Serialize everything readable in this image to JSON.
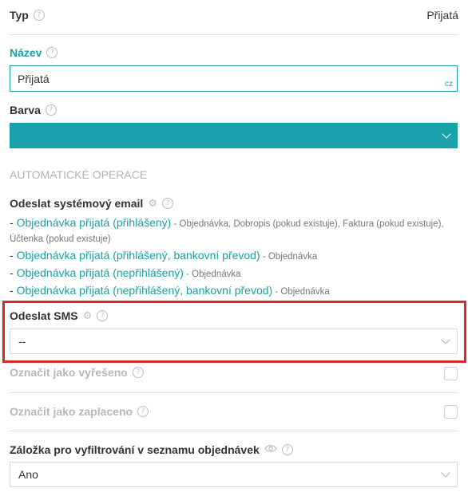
{
  "type": {
    "label": "Typ",
    "value": "Přijatá"
  },
  "name": {
    "label": "Název",
    "value": "Přijatá",
    "lang": "cz"
  },
  "color": {
    "label": "Barva",
    "value": "#1aa2ad"
  },
  "section_title": "AUTOMATICKÉ OPERACE",
  "email": {
    "label": "Odeslat systémový email",
    "items": [
      {
        "dash": "- ",
        "link": "Objednávka přijatá (přihlášený)",
        "docs_line1": " - Objednávka, Dobropis (pokud existuje), Faktura (pokud existuje),",
        "docs_line2": "Účtenka (pokud existuje)"
      },
      {
        "dash": "- ",
        "link": "Objednávka přijatá (přihlášený, bankovní převod)",
        "docs": " - Objednávka"
      },
      {
        "dash": "- ",
        "link": "Objednávka přijatá (nepřihlášený)",
        "docs": " - Objednávka"
      },
      {
        "dash": "- ",
        "link": "Objednávka přijatá (nepřihlášený, bankovní převod)",
        "docs": " - Objednávka"
      }
    ]
  },
  "sms": {
    "label": "Odeslat SMS",
    "value": "--",
    "highlight_color": "#d9272c"
  },
  "resolved": {
    "label": "Označit jako vyřešeno",
    "checked": false
  },
  "paid": {
    "label": "Označit jako zaplaceno",
    "checked": false
  },
  "filter_tab": {
    "label": "Záložka pro vyfiltrování v seznamu objednávek",
    "value": "Ano"
  },
  "icons": {
    "help": "question-circle-icon",
    "settings": "gear-icon",
    "visibility": "eye-icon",
    "dropdown": "chevron-down-icon"
  },
  "accent": "#1a9fa8",
  "help_glyph": "?",
  "gear_glyph": "⚙"
}
